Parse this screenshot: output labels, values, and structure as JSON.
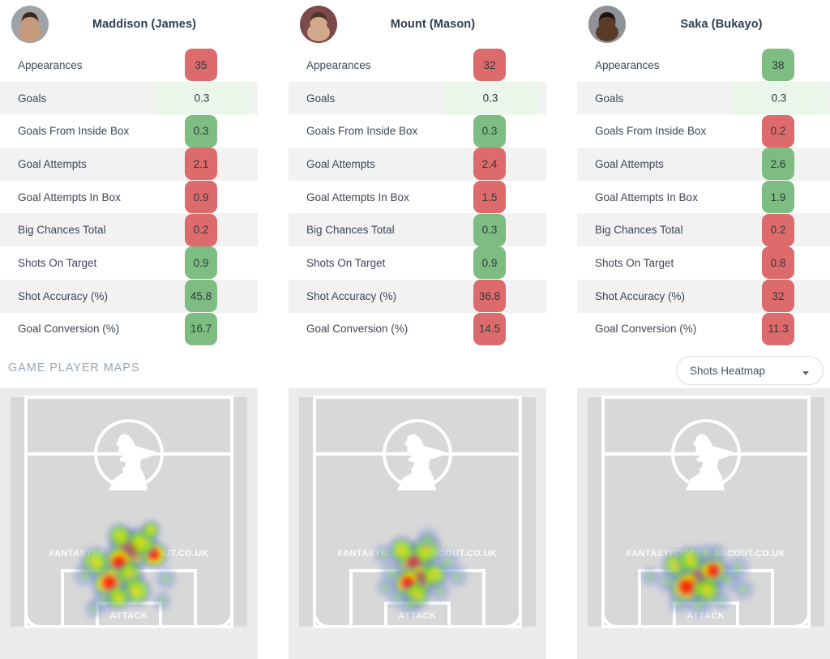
{
  "players": [
    {
      "name": "Maddison (James)",
      "avatar_name": "player-avatar-maddison",
      "stats": [
        {
          "label": "Appearances",
          "value": "35",
          "style": "red"
        },
        {
          "label": "Goals",
          "value": "0.3",
          "style": "pale"
        },
        {
          "label": "Goals From Inside Box",
          "value": "0.3",
          "style": "green"
        },
        {
          "label": "Goal Attempts",
          "value": "2.1",
          "style": "red"
        },
        {
          "label": "Goal Attempts In Box",
          "value": "0.9",
          "style": "red"
        },
        {
          "label": "Big Chances Total",
          "value": "0.2",
          "style": "red"
        },
        {
          "label": "Shots On Target",
          "value": "0.9",
          "style": "green"
        },
        {
          "label": "Shot Accuracy (%)",
          "value": "45.8",
          "style": "green"
        },
        {
          "label": "Goal Conversion (%)",
          "value": "16.7",
          "style": "green"
        }
      ]
    },
    {
      "name": "Mount (Mason)",
      "avatar_name": "player-avatar-mount",
      "stats": [
        {
          "label": "Appearances",
          "value": "32",
          "style": "red"
        },
        {
          "label": "Goals",
          "value": "0.3",
          "style": "pale"
        },
        {
          "label": "Goals From Inside Box",
          "value": "0.3",
          "style": "green"
        },
        {
          "label": "Goal Attempts",
          "value": "2.4",
          "style": "red"
        },
        {
          "label": "Goal Attempts In Box",
          "value": "1.5",
          "style": "red"
        },
        {
          "label": "Big Chances Total",
          "value": "0.3",
          "style": "green"
        },
        {
          "label": "Shots On Target",
          "value": "0.9",
          "style": "green"
        },
        {
          "label": "Shot Accuracy (%)",
          "value": "36.8",
          "style": "red"
        },
        {
          "label": "Goal Conversion (%)",
          "value": "14.5",
          "style": "red"
        }
      ]
    },
    {
      "name": "Saka (Bukayo)",
      "avatar_name": "player-avatar-saka",
      "stats": [
        {
          "label": "Appearances",
          "value": "38",
          "style": "green"
        },
        {
          "label": "Goals",
          "value": "0.3",
          "style": "pale"
        },
        {
          "label": "Goals From Inside Box",
          "value": "0.2",
          "style": "red"
        },
        {
          "label": "Goal Attempts",
          "value": "2.6",
          "style": "green"
        },
        {
          "label": "Goal Attempts In Box",
          "value": "1.9",
          "style": "green"
        },
        {
          "label": "Big Chances Total",
          "value": "0.2",
          "style": "red"
        },
        {
          "label": "Shots On Target",
          "value": "0.8",
          "style": "red"
        },
        {
          "label": "Shot Accuracy (%)",
          "value": "32",
          "style": "red"
        },
        {
          "label": "Goal Conversion (%)",
          "value": "11.3",
          "style": "red"
        }
      ]
    }
  ],
  "maps": {
    "section_title": "GAME PLAYER MAPS",
    "selected_map": "Shots Heatmap",
    "pitch_label_attack": "ATTACK",
    "watermark": "FANTASYFOOTBALLSCOUT.CO.UK"
  },
  "colors": {
    "badge_red": "#dd6b6b",
    "badge_green": "#7dbd82",
    "badge_pale_green": "#eaf6ea",
    "row_alt": "#f2f2f2",
    "label_text": "#3d4756",
    "section_title": "#9aa4b3",
    "pitch_turf": "#d8d8d8",
    "pitch_lines": "#ffffff",
    "card_bg": "#ebebeb"
  }
}
